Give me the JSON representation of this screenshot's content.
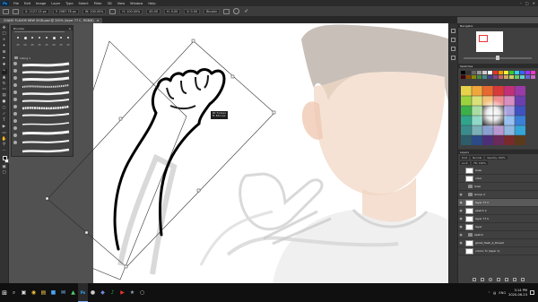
{
  "app": {
    "logo": "Ps"
  },
  "menu": [
    "File",
    "Edit",
    "Image",
    "Layer",
    "Type",
    "Select",
    "Filter",
    "3D",
    "View",
    "Window",
    "Help"
  ],
  "window_controls": [
    "–",
    "□",
    "✕"
  ],
  "options": {
    "x": "X: 1127.13 px",
    "y": "Y: 2087.78 px",
    "w": "W: 100.00%",
    "h": "H: 100.00%",
    "angle": "45.00",
    "h_skew": "H: 0.00",
    "v_skew": "V: 0.00",
    "interpolation": "Bicubic",
    "commit": "✓"
  },
  "document": {
    "tab_title": "CHASE FLAVOR NEW SIGN.psd @ 200% (layer 77 C, RGB/8)",
    "close": "×"
  },
  "tools": [
    "move",
    "marquee",
    "lasso",
    "wand",
    "crop",
    "eyedropper",
    "heal",
    "brush",
    "stamp",
    "history-brush",
    "eraser",
    "gradient",
    "blur",
    "dodge",
    "pen",
    "type",
    "path-select",
    "shape",
    "hand",
    "zoom",
    "more"
  ],
  "brushes": {
    "title": "Brushes",
    "sizes": [
      "25",
      "50",
      "25",
      "25",
      "25",
      "50",
      "25",
      "25",
      "25",
      "100",
      "100",
      "50"
    ],
    "folder": "Inking 1"
  },
  "navigator": {
    "title": "Navigator"
  },
  "swatches": {
    "title": "Swatches"
  },
  "layers": {
    "title": "Layers",
    "filter": "Kind",
    "mode": "Normal",
    "opacity": "Opacity: 100%",
    "lock": "Lock:",
    "fill": "Fill: 100%",
    "items": [
      {
        "name": "lines",
        "type": "layer",
        "eye": ""
      },
      {
        "name": "color",
        "type": "layer",
        "eye": ""
      },
      {
        "name": "lines",
        "type": "group",
        "eye": ""
      },
      {
        "name": "Group 2",
        "type": "group",
        "eye": "◉"
      },
      {
        "name": "layer 77 C",
        "type": "layer",
        "eye": "◉"
      },
      {
        "name": "sketch 2",
        "type": "layer",
        "eye": "◉"
      },
      {
        "name": "layer 77 b",
        "type": "layer",
        "eye": "◉"
      },
      {
        "name": "layer",
        "type": "layer",
        "eye": "◉"
      },
      {
        "name": "sketch",
        "type": "group",
        "eye": "◉"
      },
      {
        "name": "ghost_flash_b_thread",
        "type": "layer",
        "eye": "◉"
      },
      {
        "name": "colors: fx (layer 1)",
        "type": "layer",
        "eye": ""
      }
    ]
  },
  "transform_readout": {
    "w": "W: 71.6 px",
    "h": "H: 63.1 px"
  },
  "taskbar": {
    "apps": [
      "⌕",
      "▣",
      "◉",
      "▤",
      "■",
      "✉",
      "▲",
      "Ps",
      "●",
      "◆",
      "♪",
      "▶",
      "★",
      "○"
    ],
    "tray": [
      "⌃",
      "▤",
      "ENG"
    ],
    "time": "3:14 PM",
    "date": "2020-06-23"
  },
  "colors": {
    "accent": "#31a8ff",
    "selection_outline": "#333333"
  }
}
